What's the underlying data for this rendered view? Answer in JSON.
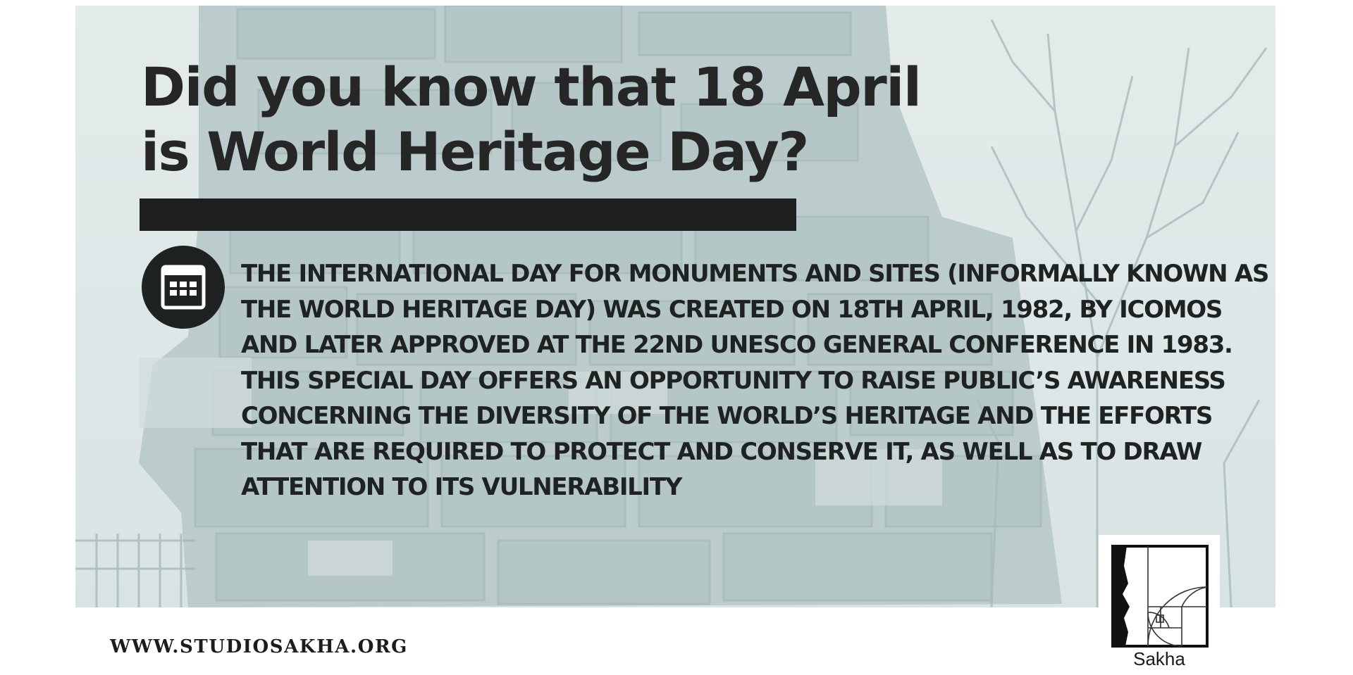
{
  "headline": {
    "line1": "Did you know that 18 April",
    "line2": "is World Heritage Day?"
  },
  "body": {
    "paragraph1": "THE INTERNATIONAL DAY FOR MONUMENTS AND SITES (INFORMALLY KNOWN AS THE WORLD HERITAGE DAY) WAS CREATED ON 18TH APRIL, 1982, BY ICOMOS AND LATER APPROVED AT THE 22ND UNESCO GENERAL CONFERENCE IN 1983.",
    "paragraph2": "THIS SPECIAL DAY OFFERS AN OPPORTUNITY TO RAISE PUBLIC’S AWARENESS CONCERNING THE DIVERSITY OF THE WORLD’S HERITAGE AND THE EFFORTS THAT ARE REQUIRED TO PROTECT AND CONSERVE IT, AS WELL AS TO DRAW ATTENTION TO ITS VULNERABILITY"
  },
  "icons": {
    "badge": "calendar-icon",
    "logo": "sakha-golden-spiral-logo"
  },
  "footer": {
    "website": "WWW.STUDIOSAKHA.ORG",
    "logo_label": "Sakha"
  },
  "colors": {
    "text": "#1f2222",
    "bar": "#1d1e1e",
    "background_tint": "#cfdcdc"
  }
}
